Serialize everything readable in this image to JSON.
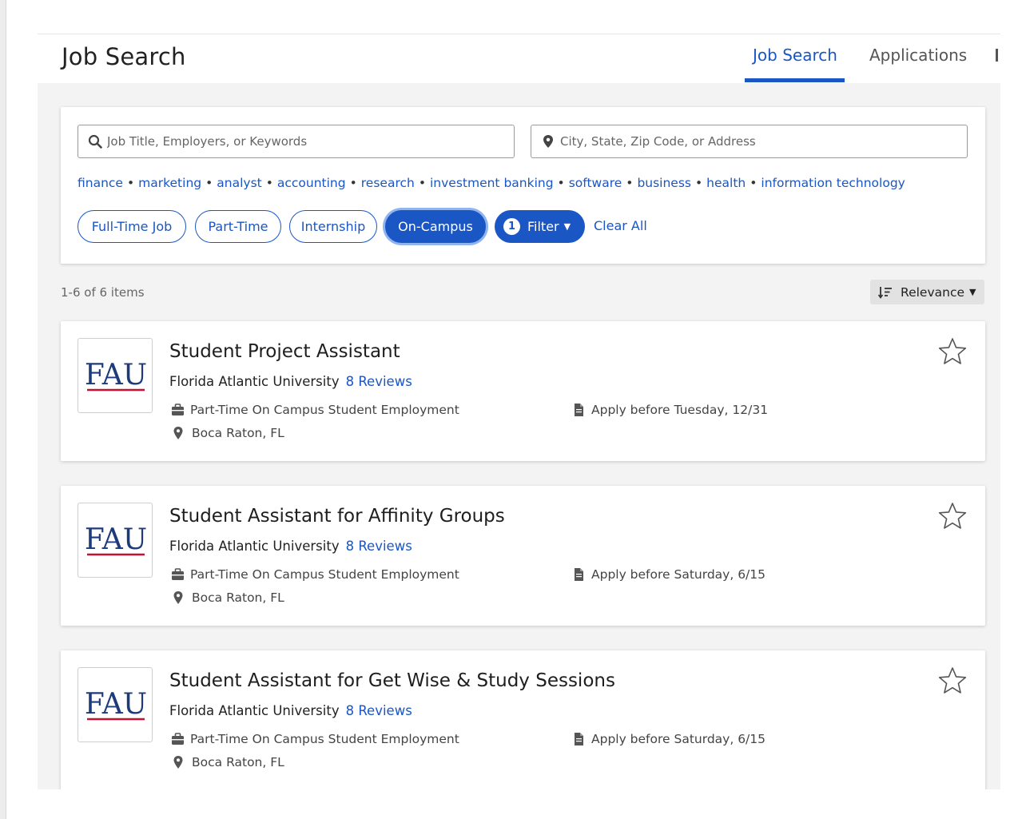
{
  "header": {
    "title": "Job Search",
    "tabs": [
      {
        "label": "Job Search",
        "active": true
      },
      {
        "label": "Applications",
        "active": false
      }
    ]
  },
  "search": {
    "keyword_placeholder": "Job Title, Employers, or Keywords",
    "location_placeholder": "City, State, Zip Code, or Address",
    "icons": {
      "keyword": "search-icon",
      "location": "map-pin-icon"
    }
  },
  "suggested_keywords": [
    "finance",
    "marketing",
    "analyst",
    "accounting",
    "research",
    "investment banking",
    "software",
    "business",
    "health",
    "information technology"
  ],
  "filters": {
    "chips": [
      {
        "label": "Full-Time Job",
        "active": false
      },
      {
        "label": "Part-Time",
        "active": false
      },
      {
        "label": "Internship",
        "active": false
      },
      {
        "label": "On-Campus",
        "active": true
      }
    ],
    "filter_button": {
      "count": "1",
      "label": "Filter"
    },
    "clear_all": "Clear All"
  },
  "results": {
    "count_text": "1-6 of 6 items",
    "sort_label": "Relevance"
  },
  "colors": {
    "accent": "#1a56c4",
    "logo_navy": "#1d3b7a",
    "logo_red": "#c8102e"
  },
  "jobs": [
    {
      "logo_text": "FAU",
      "title": "Student Project Assistant",
      "employer": "Florida Atlantic University",
      "reviews": "8 Reviews",
      "type": "Part-Time On Campus Student Employment",
      "deadline": "Apply before Tuesday, 12/31",
      "location": "Boca Raton, FL"
    },
    {
      "logo_text": "FAU",
      "title": "Student Assistant for Affinity Groups",
      "employer": "Florida Atlantic University",
      "reviews": "8 Reviews",
      "type": "Part-Time On Campus Student Employment",
      "deadline": "Apply before Saturday, 6/15",
      "location": "Boca Raton, FL"
    },
    {
      "logo_text": "FAU",
      "title": "Student Assistant for Get Wise & Study Sessions",
      "employer": "Florida Atlantic University",
      "reviews": "8 Reviews",
      "type": "Part-Time On Campus Student Employment",
      "deadline": "Apply before Saturday, 6/15",
      "location": "Boca Raton, FL"
    }
  ]
}
